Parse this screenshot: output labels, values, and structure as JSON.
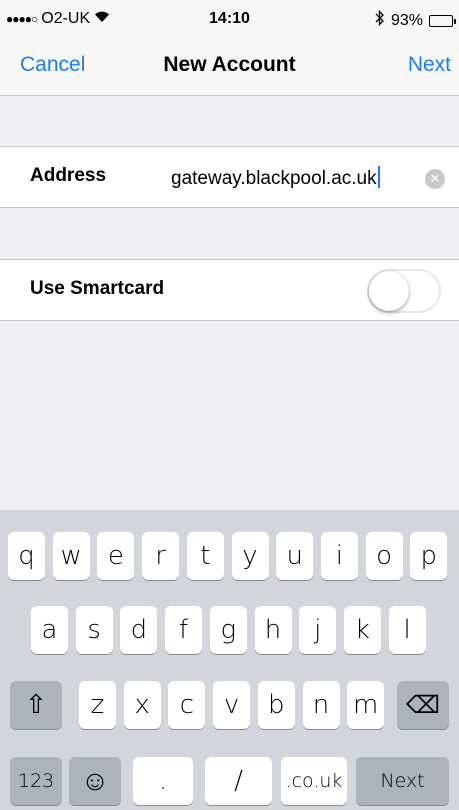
{
  "status_bar": {
    "signal": "●●●●○",
    "carrier": "O2-UK",
    "wifi": "⌔",
    "time": "14:10",
    "bluetooth": "✱",
    "battery": "93%",
    "battery_level": 0.93
  },
  "nav": {
    "cancel_label": "Cancel",
    "title": "New Account",
    "next_label": "Next"
  },
  "form": {
    "address_label": "Address",
    "address_value": "gateway.blackpool.ac.uk",
    "clear_icon": "✕",
    "smartcard_label": "Use Smartcard",
    "smartcard_on": false
  },
  "keyboard": {
    "row1": [
      "q",
      "w",
      "e",
      "r",
      "t",
      "y",
      "u",
      "i",
      "o",
      "p"
    ],
    "row2": [
      "a",
      "s",
      "d",
      "f",
      "g",
      "h",
      "j",
      "k",
      "l"
    ],
    "row3": [
      "z",
      "x",
      "c",
      "v",
      "b",
      "n",
      "m"
    ],
    "shift_icon": "⇧",
    "backspace_icon": "⌫",
    "numbers_label": "123",
    "emoji_icon": "☺",
    "period": ".",
    "slash": "/",
    "domain": ".co.uk",
    "next_label": "Next"
  },
  "colors": {
    "accent": "#1a7bf5",
    "background": "#efeff4",
    "keyboard": "#d2d5db"
  }
}
